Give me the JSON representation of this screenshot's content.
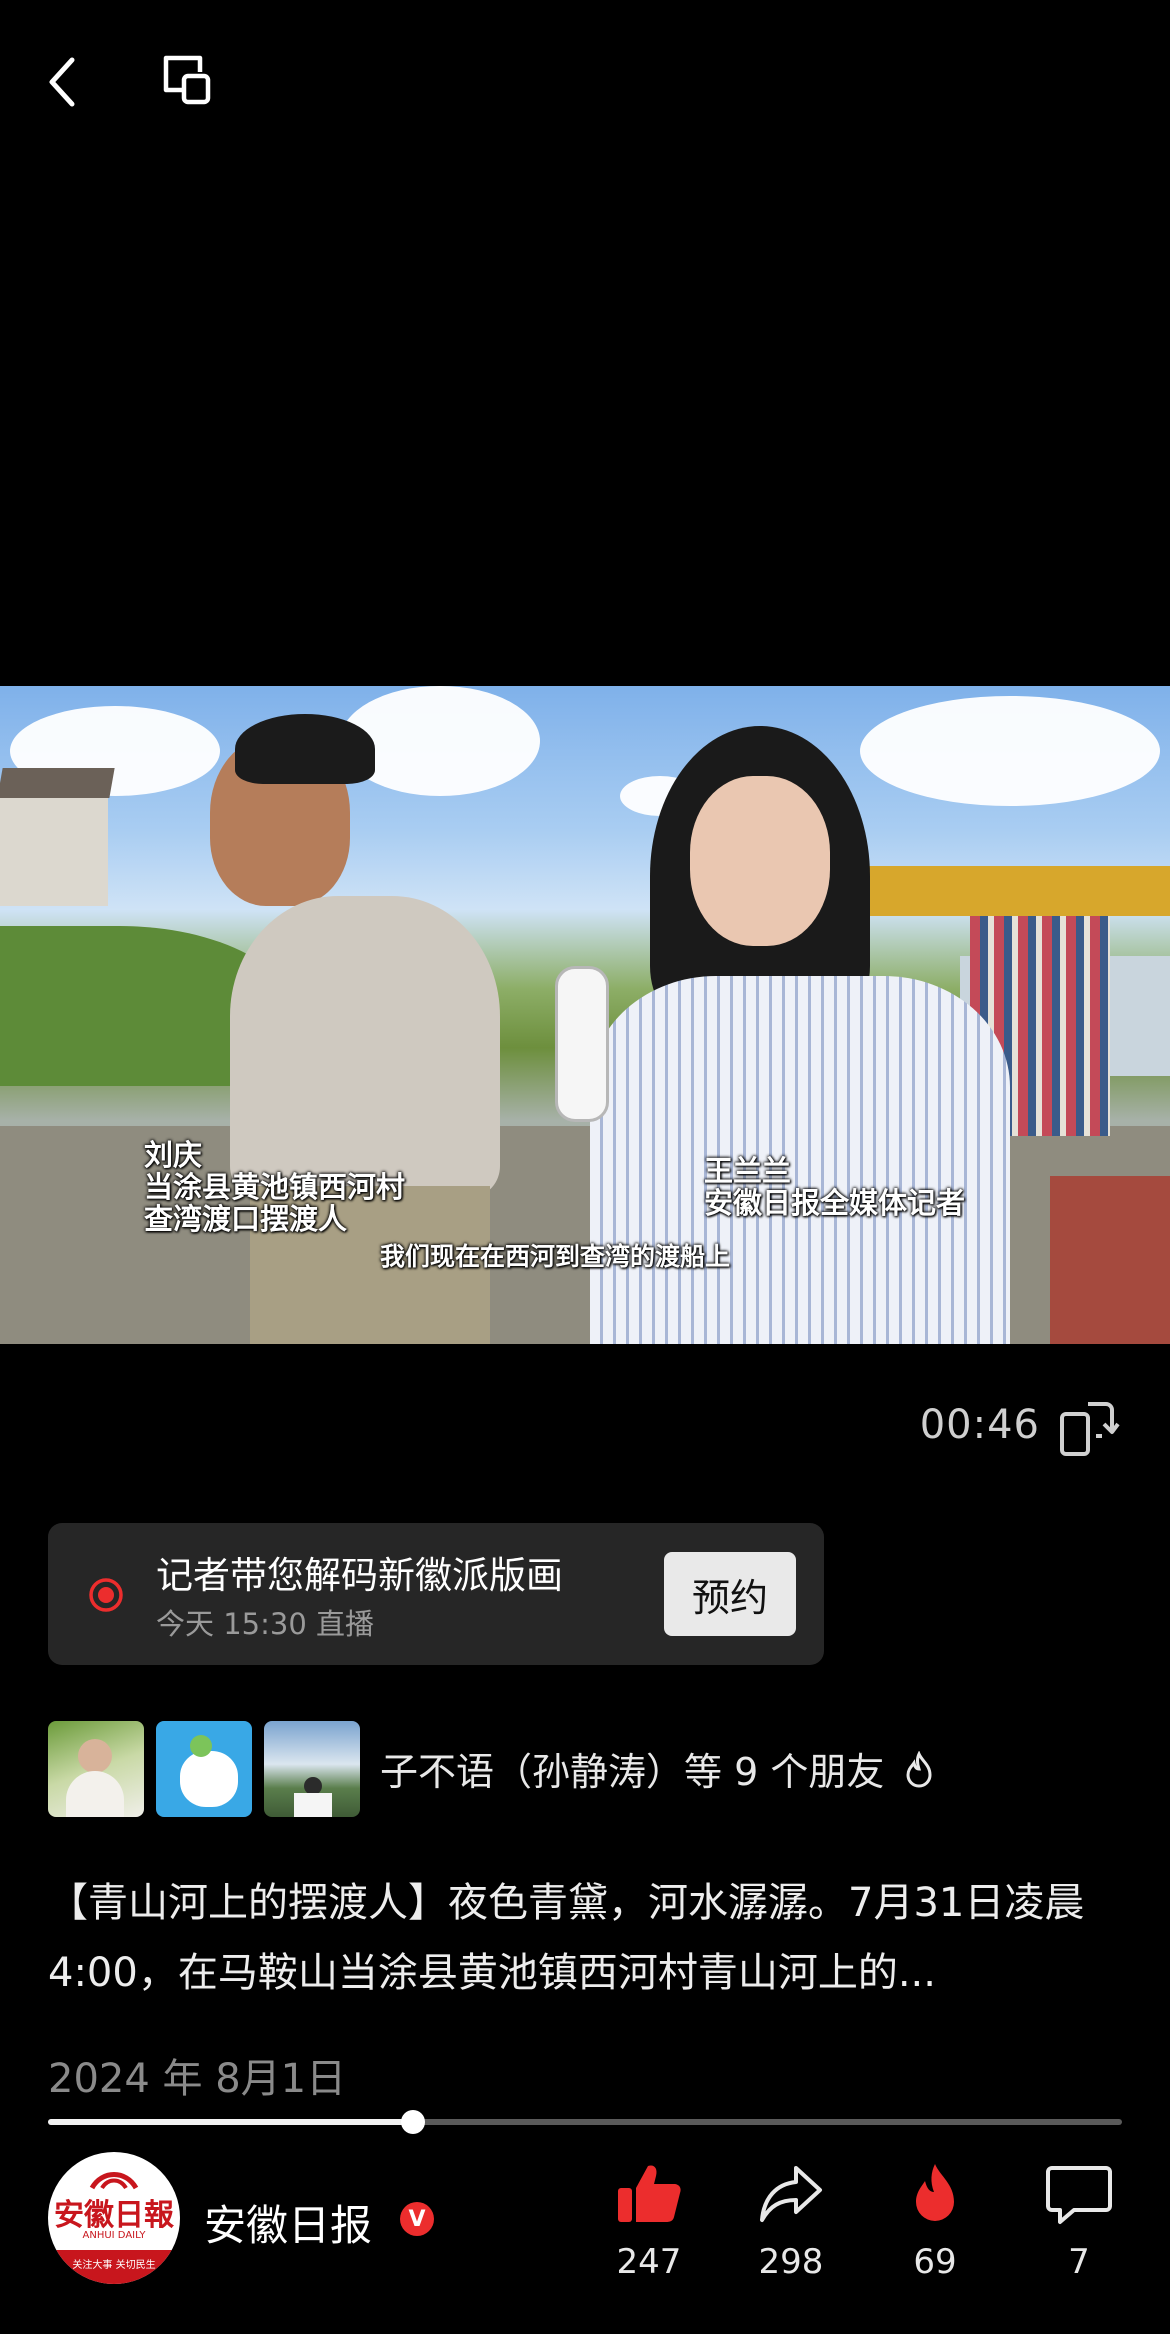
{
  "topbar": {
    "back_icon": "chevron-left-icon",
    "pip_icon": "picture-in-picture-icon"
  },
  "video": {
    "caption_left_name": "刘庆",
    "caption_left_line1": "当涂县黄池镇西河村",
    "caption_left_line2": "查湾渡口摆渡人",
    "caption_right_name": "王兰兰",
    "caption_right_role": "安徽日报全媒体记者",
    "subtitle": "我们现在在西河到查湾的渡船上",
    "time": "00:46"
  },
  "live": {
    "title": "记者带您解码新徽派版画",
    "time": "今天 15:30 直播",
    "button": "预约"
  },
  "friends": {
    "text": "子不语（孙静涛）等 9 个朋友"
  },
  "post": {
    "description": "【青山河上的摆渡人】夜色青黛，河水潺潺。7月31日凌晨 4:00，在马鞍山当涂县黄池镇西河村青山河上的...",
    "date": "2024 年 8月1日"
  },
  "progress": {
    "fraction": 0.34
  },
  "account": {
    "name": "安徽日报",
    "verified": "V",
    "logo_text": "安徽日報",
    "logo_sub": "ANHUI DAILY",
    "logo_slogan": "关注大事 关切民生"
  },
  "actions": {
    "likes": "247",
    "shares": "298",
    "hot": "69",
    "comments": "7"
  },
  "colors": {
    "accent": "#ec2d2d",
    "card_bg": "#262626",
    "background": "#000000"
  }
}
